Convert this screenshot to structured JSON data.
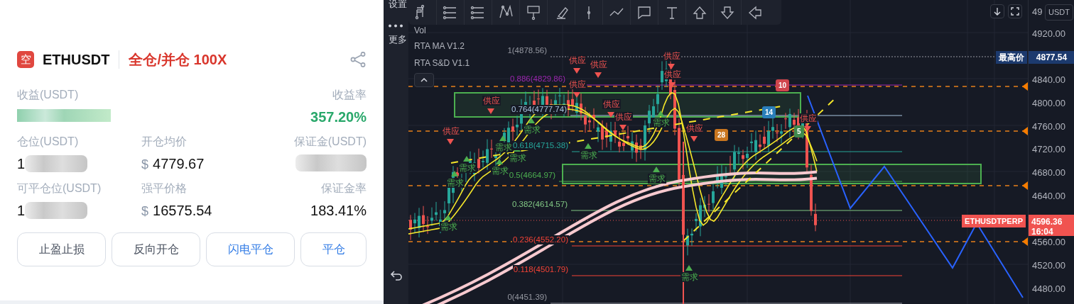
{
  "position_card": {
    "side_badge": "空",
    "symbol": "ETHUSDT",
    "margin_mode": "全仓/并仓 100X",
    "pnl": {
      "label": "收益(USDT)"
    },
    "pnl_rate": {
      "label": "收益率",
      "value": "357.20%"
    },
    "position": {
      "label": "仓位(USDT)",
      "visible_value": "1"
    },
    "entry_price": {
      "label": "开仓均价",
      "currency": "$",
      "value": "4779.67"
    },
    "margin": {
      "label": "保证金(USDT)"
    },
    "closable": {
      "label": "可平仓位(USDT)",
      "visible_value": "1"
    },
    "liq_price": {
      "label": "强平价格",
      "currency": "$",
      "value": "16575.54"
    },
    "margin_ratio": {
      "label": "保证金率",
      "value": "183.41%"
    },
    "buttons": [
      {
        "label": "止盈止损",
        "kind": "normal"
      },
      {
        "label": "反向开仓",
        "kind": "normal"
      },
      {
        "label": "闪电平仓",
        "kind": "accent"
      },
      {
        "label": "平仓",
        "kind": "accent"
      }
    ]
  },
  "chart": {
    "side_tools": [
      {
        "label": "设置"
      },
      {
        "label": "更多"
      }
    ],
    "legends": [
      "Vol",
      "RTA MA V1.2",
      "RTA S&D V1.1"
    ],
    "fib_levels": [
      {
        "label": "1(4878.56)",
        "color": "#9598a1"
      },
      {
        "label": "0.886(4829.86)",
        "color": "#9c27b0"
      },
      {
        "label": "0.764(4777.74)",
        "color": "#a9c4e0"
      },
      {
        "label": "0.618(4715.38)",
        "color": "#26a69a"
      },
      {
        "label": "0.5(4664.97)",
        "color": "#4caf50"
      },
      {
        "label": "0.382(4614.57)",
        "color": "#81c784"
      },
      {
        "label": "0.236(4552.20)",
        "color": "#f44336"
      },
      {
        "label": "0.118(4501.79)",
        "color": "#f44336"
      },
      {
        "label": "0(4451.39)",
        "color": "#9598a1"
      }
    ],
    "signals": [
      {
        "label": "供应",
        "kind": "supply"
      },
      {
        "label": "供应",
        "kind": "supply"
      },
      {
        "label": "供应",
        "kind": "supply"
      },
      {
        "label": "供应",
        "kind": "supply"
      },
      {
        "label": "供应",
        "kind": "supply"
      },
      {
        "label": "供应",
        "kind": "supply"
      },
      {
        "label": "供应",
        "kind": "supply"
      },
      {
        "label": "供应",
        "kind": "supply"
      },
      {
        "label": "供应",
        "kind": "supply"
      },
      {
        "label": "供应",
        "kind": "supply"
      },
      {
        "label": "供应",
        "kind": "supply"
      },
      {
        "label": "需求",
        "kind": "demand"
      },
      {
        "label": "需求",
        "kind": "demand"
      },
      {
        "label": "需求",
        "kind": "demand"
      },
      {
        "label": "需求",
        "kind": "demand"
      },
      {
        "label": "需求",
        "kind": "demand"
      },
      {
        "label": "需求",
        "kind": "demand"
      },
      {
        "label": "需求",
        "kind": "demand"
      },
      {
        "label": "需求",
        "kind": "demand"
      },
      {
        "label": "需求",
        "kind": "demand"
      },
      {
        "label": "需求",
        "kind": "demand"
      },
      {
        "label": "需求",
        "kind": "demand"
      }
    ],
    "count_badges": [
      {
        "label": "10",
        "color": "#d0454c"
      },
      {
        "label": "14",
        "color": "#2a7fba"
      },
      {
        "label": "28",
        "color": "#c9761f"
      },
      {
        "label": "5",
        "color": "#3f8a4c"
      }
    ],
    "price_axis": {
      "unit": "USDT",
      "ticks": [
        "49",
        "4920.00",
        "4840.00",
        "4800.00",
        "4760.00",
        "4720.00",
        "4680.00",
        "4640.00",
        "4560.00",
        "4520.00",
        "4480.00"
      ]
    },
    "high_marker": {
      "label": "最高价",
      "price": "4877.54"
    },
    "last_price": {
      "symbol": "ETHUSDTPERP",
      "price": "4596.36",
      "countdown": "16:04"
    }
  }
}
